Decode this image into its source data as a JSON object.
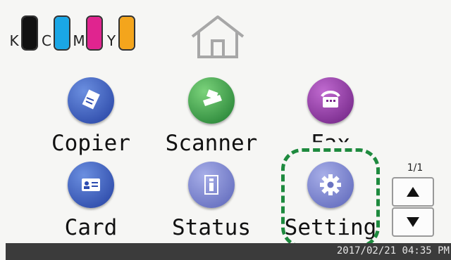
{
  "toner": {
    "labels": [
      "K",
      "C",
      "M",
      "Y"
    ],
    "colors": [
      "#111111",
      "#1aa7e6",
      "#e0248f",
      "#f4a51c"
    ]
  },
  "apps": {
    "copier": "Copier",
    "scanner": "Scanner",
    "fax": "Fax",
    "card": "Card",
    "status": "Status",
    "setting": "Setting"
  },
  "pager": {
    "page": "1/1"
  },
  "status_bar": {
    "datetime": "2017/02/21 04:35 PM"
  }
}
